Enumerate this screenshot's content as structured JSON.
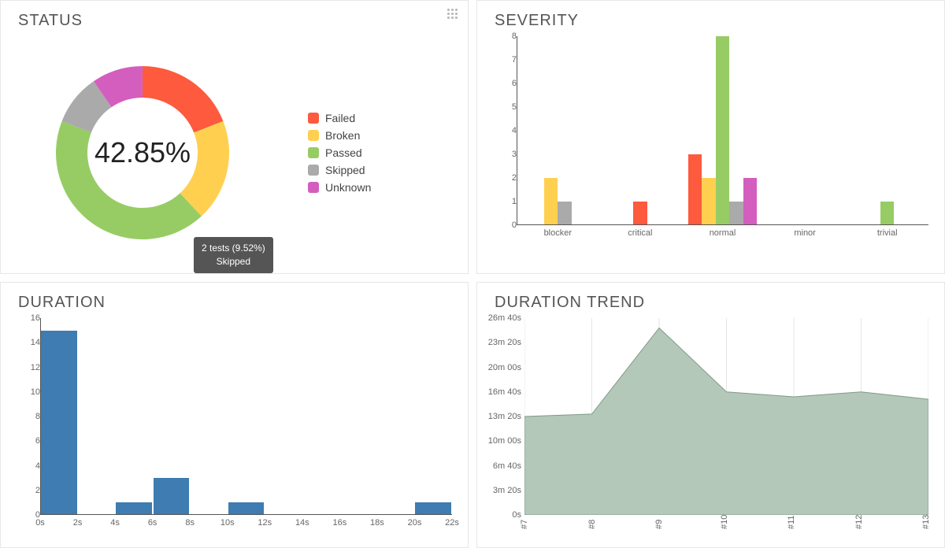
{
  "status_panel": {
    "title": "STATUS",
    "legend": [
      {
        "name": "Failed",
        "swatch": "c-failed"
      },
      {
        "name": "Broken",
        "swatch": "c-broken"
      },
      {
        "name": "Passed",
        "swatch": "c-passed"
      },
      {
        "name": "Skipped",
        "swatch": "c-skipped"
      },
      {
        "name": "Unknown",
        "swatch": "c-unknown"
      }
    ],
    "center_label": "42.85%",
    "tooltip_line1": "2 tests (9.52%)",
    "tooltip_line2": "Skipped"
  },
  "severity_panel": {
    "title": "SEVERITY"
  },
  "duration_panel": {
    "title": "DURATION"
  },
  "trend_panel": {
    "title": "DURATION TREND"
  },
  "chart_data": [
    {
      "id": "status",
      "type": "pie",
      "title": "STATUS",
      "series": [
        {
          "name": "Failed",
          "value": 4,
          "pct": 19.05,
          "color": "#fd5a3e"
        },
        {
          "name": "Broken",
          "value": 4,
          "pct": 19.05,
          "color": "#ffd050"
        },
        {
          "name": "Passed",
          "value": 9,
          "pct": 42.85,
          "color": "#97cc64"
        },
        {
          "name": "Skipped",
          "value": 2,
          "pct": 9.52,
          "color": "#aaaaaa"
        },
        {
          "name": "Unknown",
          "value": 2,
          "pct": 9.52,
          "color": "#d35ebe"
        }
      ],
      "inner_radius_pct": 60,
      "center_label": "42.85%"
    },
    {
      "id": "severity",
      "type": "bar",
      "title": "SEVERITY",
      "categories": [
        "blocker",
        "critical",
        "normal",
        "minor",
        "trivial"
      ],
      "series": [
        {
          "name": "Failed",
          "color": "#fd5a3e",
          "values": [
            0,
            1,
            3,
            0,
            0
          ]
        },
        {
          "name": "Broken",
          "color": "#ffd050",
          "values": [
            2,
            0,
            2,
            0,
            0
          ]
        },
        {
          "name": "Passed",
          "color": "#97cc64",
          "values": [
            0,
            0,
            8,
            0,
            1
          ]
        },
        {
          "name": "Skipped",
          "color": "#aaaaaa",
          "values": [
            1,
            0,
            1,
            0,
            0
          ]
        },
        {
          "name": "Unknown",
          "color": "#d35ebe",
          "values": [
            0,
            0,
            2,
            0,
            0
          ]
        }
      ],
      "ylim": [
        0,
        8
      ],
      "yticks": [
        0,
        1,
        2,
        3,
        4,
        5,
        6,
        7,
        8
      ],
      "xlabel": "",
      "ylabel": ""
    },
    {
      "id": "duration",
      "type": "bar",
      "title": "DURATION",
      "x": [
        0,
        2,
        4,
        6,
        8,
        10,
        12,
        14,
        16,
        18,
        20,
        22
      ],
      "values_by_bin_start": {
        "0": 15,
        "4": 1,
        "6": 3,
        "10": 1,
        "20": 1
      },
      "color": "#3e7cb1",
      "ylim": [
        0,
        16
      ],
      "yticks": [
        0,
        2,
        4,
        6,
        8,
        10,
        12,
        14,
        16
      ],
      "xticks": [
        "0s",
        "2s",
        "4s",
        "6s",
        "8s",
        "10s",
        "12s",
        "14s",
        "16s",
        "18s",
        "20s",
        "22s"
      ],
      "xlabel": "",
      "ylabel": ""
    },
    {
      "id": "duration_trend",
      "type": "area",
      "title": "DURATION TREND",
      "x": [
        "#7",
        "#8",
        "#9",
        "#10",
        "#11",
        "#12",
        "#13"
      ],
      "y_seconds": [
        800,
        820,
        1520,
        1000,
        960,
        1000,
        940
      ],
      "ylim_seconds": [
        0,
        1600
      ],
      "ytick_labels": [
        "0s",
        "3m 20s",
        "6m 40s",
        "10m 00s",
        "13m 20s",
        "16m 40s",
        "20m 00s",
        "23m 20s",
        "26m 40s"
      ],
      "ytick_seconds": [
        0,
        200,
        400,
        600,
        800,
        1000,
        1200,
        1400,
        1600
      ],
      "color": "#b4c8ba",
      "xlabel": "",
      "ylabel": ""
    }
  ]
}
